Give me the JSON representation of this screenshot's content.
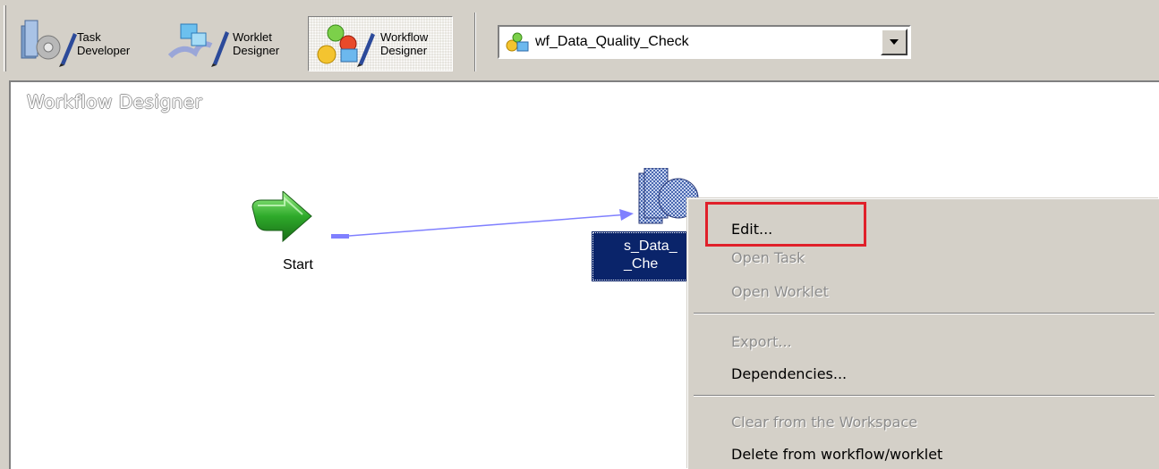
{
  "toolbar": {
    "task_developer": {
      "line1": "Task",
      "line2": "Developer"
    },
    "worklet_designer": {
      "line1": "Worklet",
      "line2": "Designer"
    },
    "workflow_designer": {
      "line1": "Workflow",
      "line2": "Designer"
    },
    "workflow_select": {
      "value": "wf_Data_Quality_Check"
    }
  },
  "canvas": {
    "title": "Workflow Designer",
    "start_node": {
      "label": "Start"
    },
    "session_node": {
      "line1": "s_Data_",
      "line2": "_Che"
    }
  },
  "context_menu": {
    "items": [
      {
        "label": "Edit...",
        "enabled": true
      },
      {
        "label": "Open Task",
        "enabled": false
      },
      {
        "label": "Open Worklet",
        "enabled": false
      },
      {
        "label": "Export...",
        "enabled": false
      },
      {
        "label": "Dependencies...",
        "enabled": true
      },
      {
        "label": "Clear from the Workspace",
        "enabled": false
      },
      {
        "label": "Delete from workflow/worklet",
        "enabled": true
      }
    ]
  },
  "colors": {
    "window_bg": "#d4d0c8",
    "selection_bg": "#0a246a",
    "highlight_border": "#e0202a",
    "link_line": "#8080ff"
  }
}
